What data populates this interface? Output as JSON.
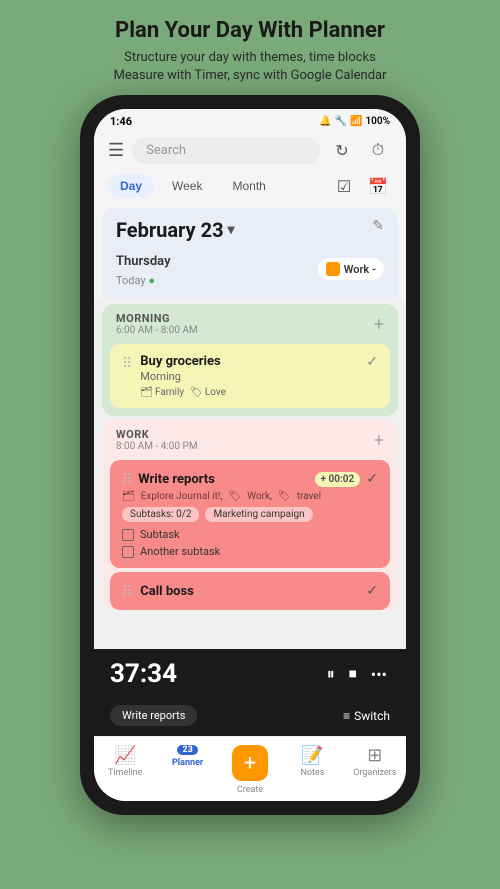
{
  "header": {
    "title": "Plan Your Day With Planner",
    "subtitle1": "Structure your day with themes, time blocks",
    "subtitle2": "Measure with Timer, sync with Google Calendar"
  },
  "statusBar": {
    "time": "1:46",
    "icons": "🔔 🔧 📡",
    "battery": "100%"
  },
  "appHeader": {
    "searchPlaceholder": "Search",
    "refreshIcon": "↻",
    "timerIcon": "⏱"
  },
  "tabs": {
    "day": "Day",
    "week": "Week",
    "month": "Month",
    "checkIcon": "☑",
    "calIcon": "📅"
  },
  "dateSection": {
    "date": "February 23",
    "chevron": "▾",
    "dayLabel": "Thursday",
    "todayLabel": "Today",
    "workLabel": "Work -",
    "editIcon": "✎"
  },
  "morningSection": {
    "sectionLabel": "MORNING",
    "timeRange": "6:00 AM - 8:00 AM",
    "task": {
      "title": "Buy groceries",
      "subtitle": "Morning",
      "tag1": "Family",
      "tag2": "Love"
    }
  },
  "workSection": {
    "sectionLabel": "WORK",
    "timeRange": "8:00 AM - 4:00 PM",
    "task1": {
      "title": "Write reports",
      "context": "Work",
      "timerBadge": "+ 00:02",
      "tag1": "Explore Journal it!,",
      "tag2": "Work,",
      "tag3": "travel",
      "chip1": "Subtasks: 0/2",
      "chip2": "Marketing campaign",
      "subtask1": "Subtask",
      "subtask2": "Another subtask"
    },
    "task2": {
      "title": "Call boss"
    }
  },
  "timerBar": {
    "time": "37:34",
    "taskLabel": "Write reports",
    "switchLabel": "Switch"
  },
  "bottomNav": {
    "timeline": "Timeline",
    "planner": "Planner",
    "plannerBadge": "23",
    "create": "Create",
    "notes": "Notes",
    "organizers": "Organizers"
  }
}
